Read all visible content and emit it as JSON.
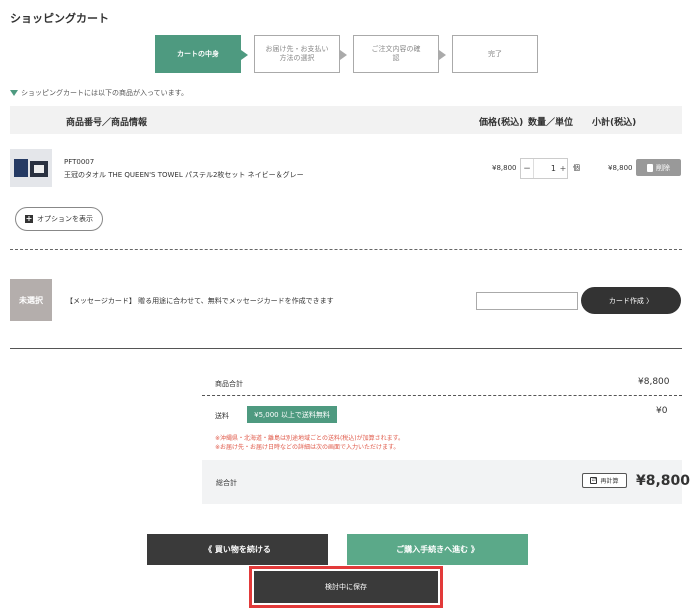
{
  "page": {
    "title": "ショッピングカート"
  },
  "steps": [
    {
      "label": "カートの中身"
    },
    {
      "label": "お届け先・お支払い方法の選択"
    },
    {
      "label": "ご注文内容の確認"
    },
    {
      "label": "完了"
    }
  ],
  "notice": "ショッピングカートには以下の商品が入っています。",
  "table_header": {
    "product": "商品番号／商品情報",
    "price": "価格(税込)",
    "qty": "数量／単位",
    "subtotal": "小計(税込)"
  },
  "item": {
    "sku": "PFT0007",
    "name": "王冠のタオル THE QUEEN'S TOWEL パステル2枚セット ネイビー＆グレー",
    "price": "¥8,800",
    "qty_minus": "−",
    "qty": "1",
    "qty_plus": "+",
    "unit": "個",
    "subtotal": "¥8,800",
    "delete_label": "削除"
  },
  "options_button": "オプションを表示",
  "message_card": {
    "thumb_label": "未選択",
    "text": "【メッセージカード】 贈る用途に合わせて、無料でメッセージカードを作成できます",
    "input_value": "",
    "button_label": "カード作成 〉"
  },
  "summary": {
    "goods_total_label": "商品合計",
    "goods_total_value": "¥8,800",
    "shipping_label": "送料",
    "shipping_badge": "¥5,000 以上で送料無料",
    "shipping_value": "¥0",
    "note_1": "※沖縄県・北海道・離島は別途地域ごとの送料(税込)が加算されます。",
    "note_2": "※お届け先・お届け日時などの詳細は次の画面で入力いただけます。",
    "grand_total_label": "総合計",
    "recalc_label": "再計算",
    "grand_total_value": "¥8,800"
  },
  "buttons": {
    "continue": "《 買い物を続ける",
    "proceed": "ご購入手続きへ進む 》",
    "save": "検討中に保存"
  },
  "colors": {
    "accent": "#4e9a80",
    "dark": "#3a3a3a",
    "highlight": "#e23a3a"
  }
}
